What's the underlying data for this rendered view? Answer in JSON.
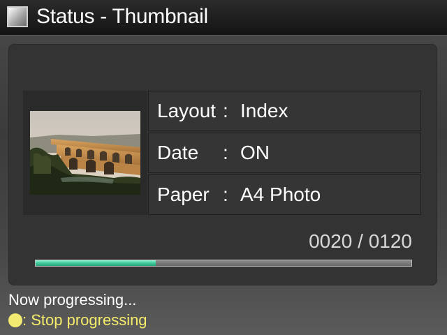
{
  "title": {
    "icon": "status-square-icon",
    "text": "Status - Thumbnail"
  },
  "thumbnail": {
    "icon": "aqueduct-photo-thumbnail"
  },
  "info": [
    {
      "label": "Layout",
      "separator": ":",
      "value": "Index"
    },
    {
      "label": "Date",
      "separator": ":",
      "value": "ON"
    },
    {
      "label": "Paper",
      "separator": ":",
      "value": "A4 Photo"
    }
  ],
  "progress": {
    "counter_text": "0020 / 0120",
    "fraction": 0.32,
    "fill_color": "#3fc99a"
  },
  "footer": {
    "status_text": "Now progressing...",
    "hint_icon": "yellow-button-icon",
    "hint_text": ": Stop progressing",
    "hint_color": "#f4ec6a"
  }
}
